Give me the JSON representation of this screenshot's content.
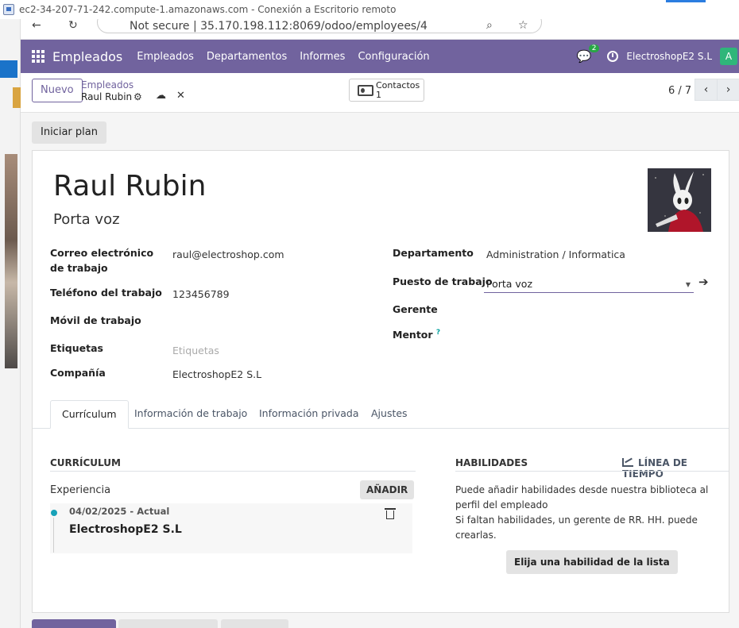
{
  "window": {
    "title": "ec2-34-207-71-242.compute-1.amazonaws.com - Conexión a Escritorio remoto"
  },
  "browser": {
    "url": "Not secure  |  35.170.198.112:8069/odoo/employees/4"
  },
  "navbar": {
    "app_name": "Empleados",
    "menu": [
      "Empleados",
      "Departamentos",
      "Informes",
      "Configuración"
    ],
    "chat_count": "2",
    "company": "ElectroshopE2 S.L",
    "avatar_letter": "A",
    "color": "#71639e"
  },
  "control_panel": {
    "new_label": "Nuevo",
    "breadcrumb_parent": "Empleados",
    "breadcrumb_current": "Raul Rubin",
    "contacts_label": "Contactos",
    "contacts_count": "1",
    "pager": "6 / 7"
  },
  "actions": {
    "start_plan": "Iniciar plan"
  },
  "employee": {
    "name": "Raul Rubin",
    "job_title": "Porta voz",
    "fields_left": [
      {
        "label": "Correo electrónico de trabajo",
        "value": "raul@electroshop.com"
      },
      {
        "label": "Teléfono del trabajo",
        "value": "123456789"
      },
      {
        "label": "Móvil de trabajo",
        "value": ""
      },
      {
        "label": "Etiquetas",
        "placeholder": "Etiquetas"
      },
      {
        "label": "Compañía",
        "value": "ElectroshopE2 S.L"
      }
    ],
    "fields_right": [
      {
        "label": "Departamento",
        "value": "Administration / Informatica"
      },
      {
        "label": "Puesto de trabajo",
        "value": "Porta voz"
      },
      {
        "label": "Gerente",
        "value": ""
      },
      {
        "label": "Mentor",
        "help": "?"
      }
    ]
  },
  "tabs": [
    "Currículum",
    "Información de trabajo",
    "Información privada",
    "Ajustes"
  ],
  "resume": {
    "title": "CURRÍCULUM",
    "experience_label": "Experiencia",
    "add_label": "AÑADIR",
    "entries": [
      {
        "date": "04/02/2025 - Actual",
        "company": "ElectroshopE2 S.L"
      }
    ]
  },
  "skills": {
    "title": "HABILIDADES",
    "timeline_label": "LÍNEA DE TIEMPO",
    "text_1": "Puede añadir habilidades desde nuestra biblioteca al perfil del empleado",
    "text_2": "Si faltan habilidades, un gerente de RR. HH. puede crearlas.",
    "pick_label": "Elija una habilidad de la lista"
  }
}
